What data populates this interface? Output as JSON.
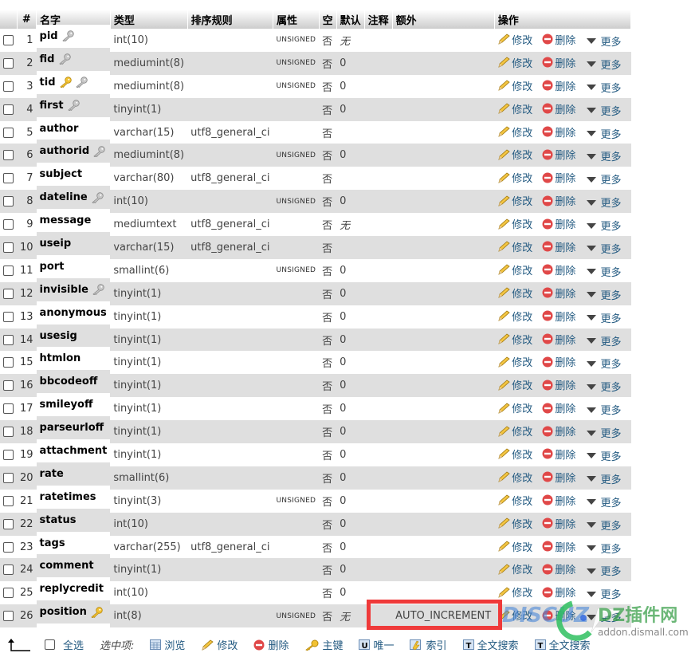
{
  "headers": [
    "#",
    "名字",
    "类型",
    "排序规则",
    "属性",
    "空",
    "默认",
    "注释",
    "额外",
    "操作"
  ],
  "actions": {
    "edit": "修改",
    "drop": "删除",
    "more": "更多"
  },
  "rows": [
    {
      "num": "1",
      "name": "pid",
      "keys": [
        "index"
      ],
      "type": "int(10)",
      "collation": "",
      "attr": "UNSIGNED",
      "null": "否",
      "default": "无",
      "default_italic": true,
      "extra": ""
    },
    {
      "num": "2",
      "name": "fid",
      "keys": [
        "index"
      ],
      "type": "mediumint(8)",
      "collation": "",
      "attr": "UNSIGNED",
      "null": "否",
      "default": "0",
      "extra": ""
    },
    {
      "num": "3",
      "name": "tid",
      "keys": [
        "primary",
        "index"
      ],
      "type": "mediumint(8)",
      "collation": "",
      "attr": "UNSIGNED",
      "null": "否",
      "default": "0",
      "extra": ""
    },
    {
      "num": "4",
      "name": "first",
      "keys": [
        "index"
      ],
      "type": "tinyint(1)",
      "collation": "",
      "attr": "",
      "null": "否",
      "default": "0",
      "extra": ""
    },
    {
      "num": "5",
      "name": "author",
      "keys": [],
      "type": "varchar(15)",
      "collation": "utf8_general_ci",
      "attr": "",
      "null": "否",
      "default": "",
      "extra": ""
    },
    {
      "num": "6",
      "name": "authorid",
      "keys": [
        "index"
      ],
      "type": "mediumint(8)",
      "collation": "",
      "attr": "UNSIGNED",
      "null": "否",
      "default": "0",
      "extra": ""
    },
    {
      "num": "7",
      "name": "subject",
      "keys": [],
      "type": "varchar(80)",
      "collation": "utf8_general_ci",
      "attr": "",
      "null": "否",
      "default": "",
      "extra": ""
    },
    {
      "num": "8",
      "name": "dateline",
      "keys": [
        "index"
      ],
      "type": "int(10)",
      "collation": "",
      "attr": "UNSIGNED",
      "null": "否",
      "default": "0",
      "extra": ""
    },
    {
      "num": "9",
      "name": "message",
      "keys": [],
      "type": "mediumtext",
      "collation": "utf8_general_ci",
      "attr": "",
      "null": "否",
      "default": "无",
      "default_italic": true,
      "extra": ""
    },
    {
      "num": "10",
      "name": "useip",
      "keys": [],
      "type": "varchar(15)",
      "collation": "utf8_general_ci",
      "attr": "",
      "null": "否",
      "default": "",
      "extra": ""
    },
    {
      "num": "11",
      "name": "port",
      "keys": [],
      "type": "smallint(6)",
      "collation": "",
      "attr": "UNSIGNED",
      "null": "否",
      "default": "0",
      "extra": ""
    },
    {
      "num": "12",
      "name": "invisible",
      "keys": [
        "index"
      ],
      "type": "tinyint(1)",
      "collation": "",
      "attr": "",
      "null": "否",
      "default": "0",
      "extra": ""
    },
    {
      "num": "13",
      "name": "anonymous",
      "keys": [],
      "type": "tinyint(1)",
      "collation": "",
      "attr": "",
      "null": "否",
      "default": "0",
      "extra": ""
    },
    {
      "num": "14",
      "name": "usesig",
      "keys": [],
      "type": "tinyint(1)",
      "collation": "",
      "attr": "",
      "null": "否",
      "default": "0",
      "extra": ""
    },
    {
      "num": "15",
      "name": "htmlon",
      "keys": [],
      "type": "tinyint(1)",
      "collation": "",
      "attr": "",
      "null": "否",
      "default": "0",
      "extra": ""
    },
    {
      "num": "16",
      "name": "bbcodeoff",
      "keys": [],
      "type": "tinyint(1)",
      "collation": "",
      "attr": "",
      "null": "否",
      "default": "0",
      "extra": ""
    },
    {
      "num": "17",
      "name": "smileyoff",
      "keys": [],
      "type": "tinyint(1)",
      "collation": "",
      "attr": "",
      "null": "否",
      "default": "0",
      "extra": ""
    },
    {
      "num": "18",
      "name": "parseurloff",
      "keys": [],
      "type": "tinyint(1)",
      "collation": "",
      "attr": "",
      "null": "否",
      "default": "0",
      "extra": ""
    },
    {
      "num": "19",
      "name": "attachment",
      "keys": [],
      "type": "tinyint(1)",
      "collation": "",
      "attr": "",
      "null": "否",
      "default": "0",
      "extra": ""
    },
    {
      "num": "20",
      "name": "rate",
      "keys": [],
      "type": "smallint(6)",
      "collation": "",
      "attr": "",
      "null": "否",
      "default": "0",
      "extra": ""
    },
    {
      "num": "21",
      "name": "ratetimes",
      "keys": [],
      "type": "tinyint(3)",
      "collation": "",
      "attr": "UNSIGNED",
      "null": "否",
      "default": "0",
      "extra": ""
    },
    {
      "num": "22",
      "name": "status",
      "keys": [],
      "type": "int(10)",
      "collation": "",
      "attr": "",
      "null": "否",
      "default": "0",
      "extra": ""
    },
    {
      "num": "23",
      "name": "tags",
      "keys": [],
      "type": "varchar(255)",
      "collation": "utf8_general_ci",
      "attr": "",
      "null": "否",
      "default": "0",
      "extra": ""
    },
    {
      "num": "24",
      "name": "comment",
      "keys": [],
      "type": "tinyint(1)",
      "collation": "",
      "attr": "",
      "null": "否",
      "default": "0",
      "extra": ""
    },
    {
      "num": "25",
      "name": "replycredit",
      "keys": [],
      "type": "int(10)",
      "collation": "",
      "attr": "",
      "null": "否",
      "default": "0",
      "extra": ""
    },
    {
      "num": "26",
      "name": "position",
      "keys": [
        "primary"
      ],
      "type": "int(8)",
      "collation": "",
      "attr": "UNSIGNED",
      "null": "否",
      "default": "无",
      "default_italic": true,
      "extra": "AUTO_INCREMENT"
    }
  ],
  "footer": {
    "select_all": "全选",
    "with_selected": "选中项:",
    "browse": "浏览",
    "edit": "修改",
    "drop": "删除",
    "primary": "主键",
    "unique": "唯一",
    "index": "索引",
    "fulltext1": "全文搜索",
    "fulltext2": "全文搜索"
  },
  "watermark": {
    "brand": "DZ插件网",
    "url": "addon.dismall.com"
  },
  "colors": {
    "link": "#235a81",
    "row_even": "#dfdfdf",
    "highlight": "#ef3a3a"
  }
}
